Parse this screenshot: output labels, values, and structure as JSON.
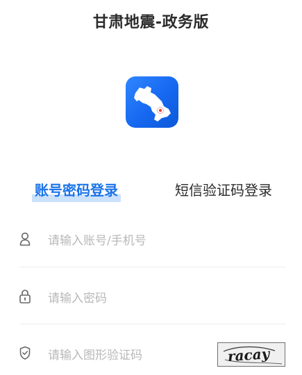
{
  "app": {
    "title": "甘肃地震-政务版"
  },
  "tabs": [
    {
      "label": "账号密码登录",
      "active": true
    },
    {
      "label": "短信验证码登录",
      "active": false
    }
  ],
  "fields": {
    "account": {
      "placeholder": "请输入账号/手机号",
      "icon": "user-icon"
    },
    "password": {
      "placeholder": "请输入密码",
      "icon": "lock-icon"
    },
    "captcha": {
      "placeholder": "请输入图形验证码",
      "icon": "shield-icon",
      "captcha_text": "racay"
    }
  },
  "colors": {
    "accent": "#1a73e8",
    "logo_bg": "#1668f0",
    "placeholder": "#b8b8b8"
  }
}
